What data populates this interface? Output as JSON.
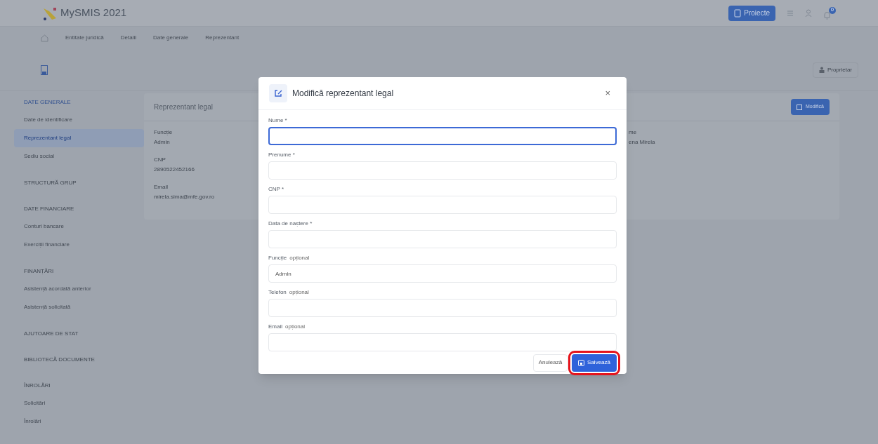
{
  "header": {
    "brand": "MySMIS 2021",
    "projects_button": "Proiecte",
    "notification_count": "0"
  },
  "breadcrumb": [
    "Entitate juridică",
    "Detalii",
    "Date generale",
    "Reprezentant"
  ],
  "owner_button": "Proprietar",
  "sidebar": [
    {
      "heading": "DATE GENERALE",
      "selected": true,
      "items": [
        {
          "label": "Date de identificare",
          "selected": false
        },
        {
          "label": "Reprezentant legal",
          "selected": true
        },
        {
          "label": "Sediu social",
          "selected": false
        }
      ]
    },
    {
      "heading": "STRUCTURĂ GRUP",
      "selected": false
    },
    {
      "heading": "DATE FINANCIARE",
      "selected": false,
      "items": [
        {
          "label": "Conturi bancare",
          "selected": false
        },
        {
          "label": "Exerciții financiare",
          "selected": false
        }
      ]
    },
    {
      "heading": "FINANȚĂRI",
      "selected": false,
      "items": [
        {
          "label": "Asistență acordată anterior",
          "selected": false
        },
        {
          "label": "Asistență solicitată",
          "selected": false
        }
      ]
    },
    {
      "heading": "AJUTOARE DE STAT",
      "selected": false
    },
    {
      "heading": "BIBLIOTECĂ DOCUMENTE",
      "selected": false
    },
    {
      "heading": "ÎNROLĂRI",
      "selected": false,
      "items": [
        {
          "label": "Solicitări",
          "selected": false
        },
        {
          "label": "Înrolări",
          "selected": false
        }
      ]
    }
  ],
  "card": {
    "title": "Reprezentant legal",
    "edit_button": "Modifică",
    "left_fields": [
      {
        "label": "Funcție",
        "value": "Admin"
      },
      {
        "label": "CNP",
        "value": "2890522452166"
      },
      {
        "label": "Email",
        "value": "mirela.sima@mfe.gov.ro"
      }
    ],
    "right_fields": [
      {
        "label": "me",
        "value": "ena Mirela"
      }
    ]
  },
  "modal": {
    "title": "Modifică reprezentant legal",
    "close": "×",
    "fields": [
      {
        "label": "Nume *",
        "focused": true
      },
      {
        "label": "Prenume *",
        "focused": false
      },
      {
        "label": "CNP *",
        "focused": false
      },
      {
        "label": "Data de naștere *",
        "focused": false
      },
      {
        "label": "Funcție",
        "hint": "opțional",
        "value": "Admin",
        "focused": false
      },
      {
        "label": "Telefon",
        "hint": "opțional",
        "focused": false
      },
      {
        "label": "Email",
        "hint": "opțional",
        "focused": false
      }
    ],
    "cancel_button": "Anulează",
    "save_button": {
      "label": "Salvează",
      "highlighted": true
    }
  }
}
